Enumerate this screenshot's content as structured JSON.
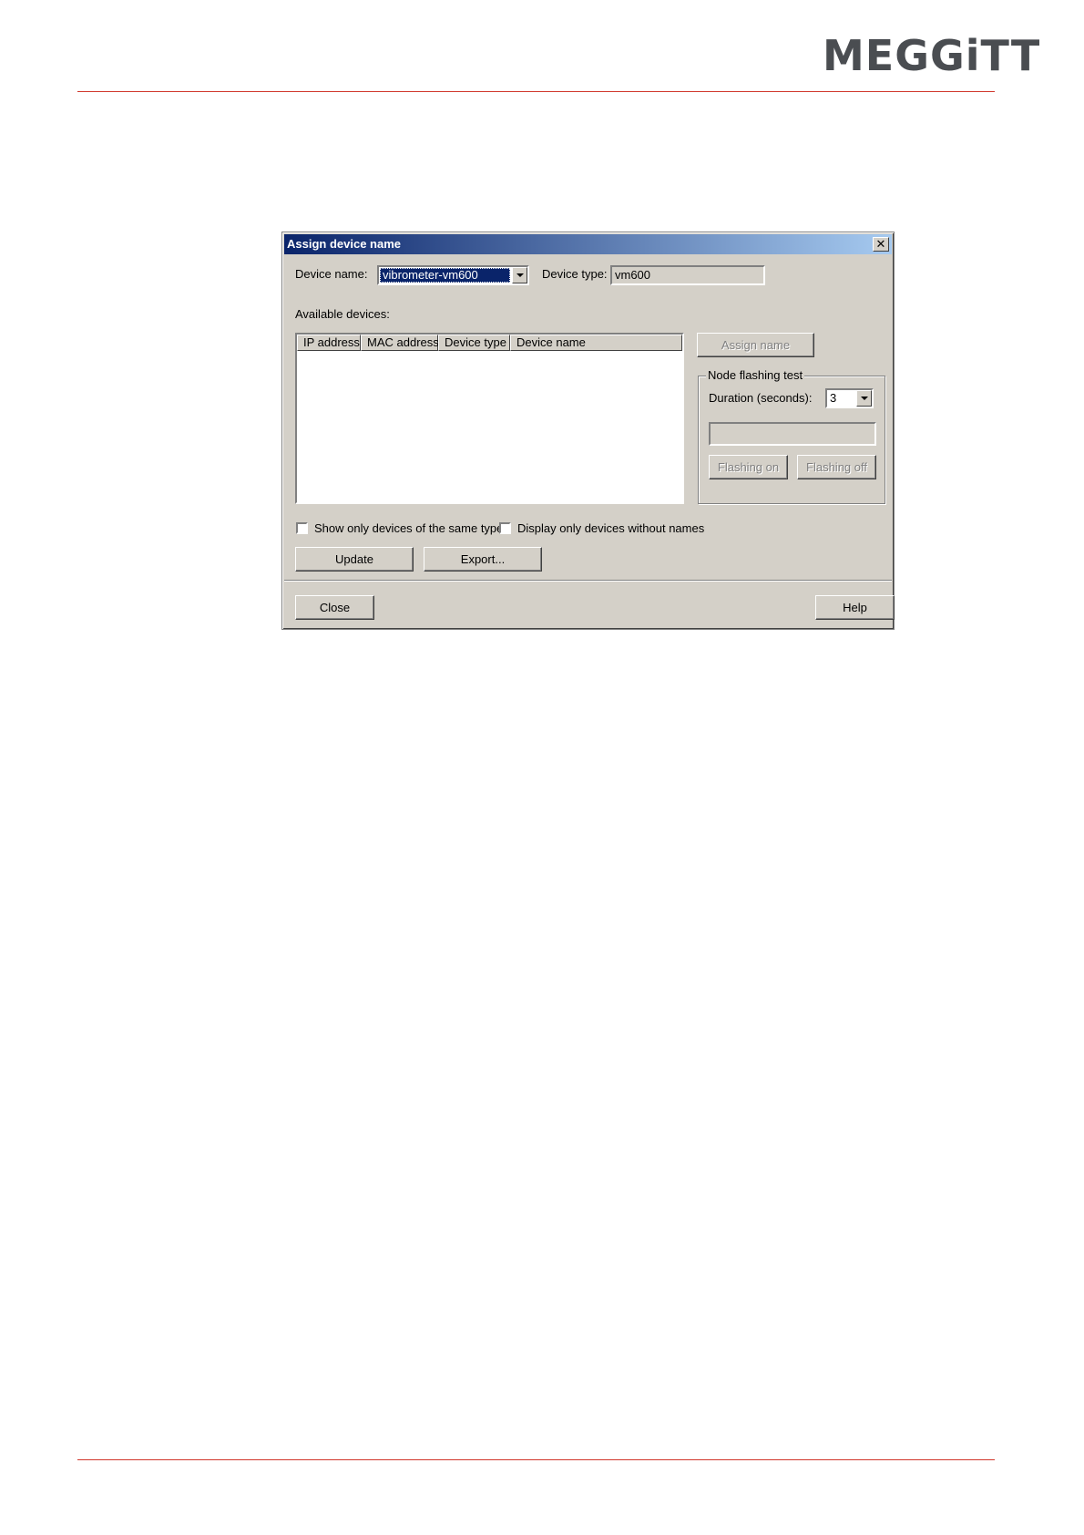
{
  "header": {
    "logo_text": "MEGGiTT"
  },
  "dialog": {
    "title": "Assign device name",
    "close_glyph": "✕",
    "device_name_label": "Device name:",
    "device_name_value": "vibrometer-vm600",
    "device_type_label": "Device type:",
    "device_type_value": "vm600",
    "available_devices_label": "Available devices:",
    "columns": [
      "IP address",
      "MAC address",
      "Device type",
      "Device name"
    ],
    "rows": [],
    "assign_name_button": "Assign name",
    "node_flashing": {
      "group_label": "Node flashing test",
      "duration_label": "Duration (seconds):",
      "duration_value": "3",
      "flashing_on_button": "Flashing on",
      "flashing_off_button": "Flashing off"
    },
    "checkbox_same_type": {
      "label": "Show only devices of the same type",
      "checked": false
    },
    "checkbox_without_names": {
      "label": "Display only devices without names",
      "checked": false
    },
    "update_button": "Update",
    "export_button": "Export...",
    "close_button": "Close",
    "help_button": "Help"
  },
  "colors": {
    "accent_rule": "#d1362b",
    "titlebar_start": "#0a246a",
    "titlebar_end": "#a6caf0",
    "dialog_face": "#d4d0c8",
    "logo": "#4a4d51"
  }
}
